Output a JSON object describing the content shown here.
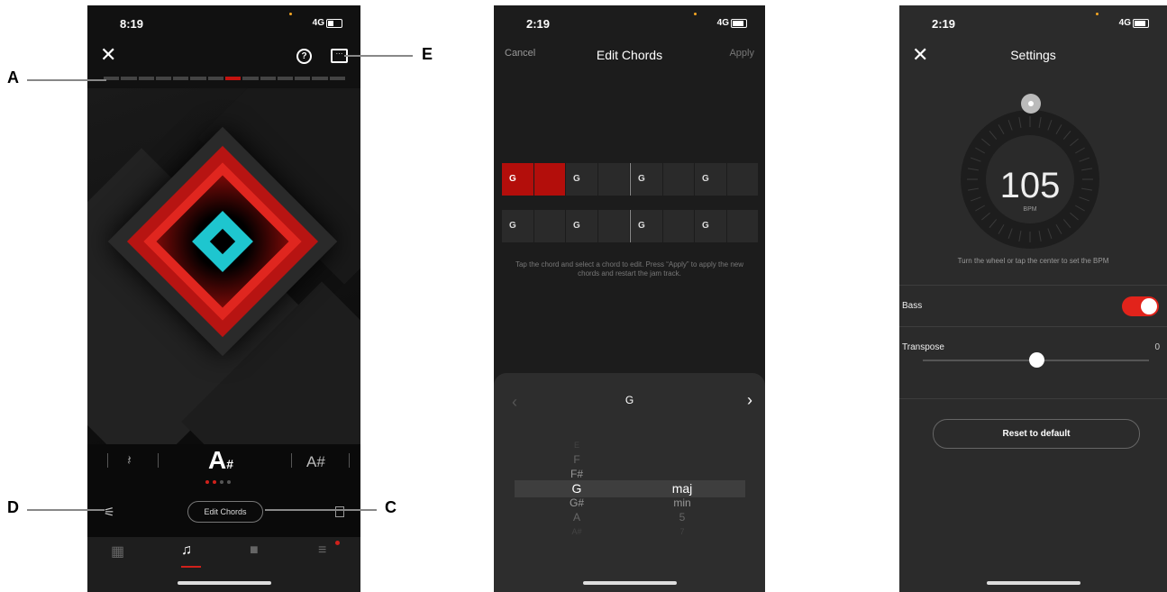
{
  "screen1": {
    "time": "8:19",
    "network": "4G",
    "battery_level": 0.4,
    "progress_segments": 14,
    "active_segment": 7,
    "rest_symbol": "𝄽",
    "current_chord": "A",
    "current_chord_accidental": "#",
    "next_chord": "A#",
    "page_dots": 4,
    "active_dot": 1,
    "edit_chords": "Edit Chords",
    "tabs": [
      "gig-icon",
      "music-icon",
      "video-icon",
      "menu-icon"
    ],
    "active_tab": 1
  },
  "screen2": {
    "time": "2:19",
    "network": "4G",
    "cancel": "Cancel",
    "title": "Edit Chords",
    "apply": "Apply",
    "row1": [
      "G",
      "",
      "G",
      "",
      "G",
      "",
      "G",
      ""
    ],
    "row2": [
      "G",
      "",
      "G",
      "",
      "G",
      "",
      "G",
      ""
    ],
    "hint": "Tap the chord and select a chord to edit. Press “Apply” to apply the new chords and restart the jam track.",
    "selected_root": "G",
    "roots": [
      "E",
      "F",
      "F#",
      "G",
      "G#",
      "A",
      "A#"
    ],
    "qualities": [
      "",
      "",
      "",
      "maj",
      "min",
      "5",
      "7"
    ]
  },
  "screen3": {
    "time": "2:19",
    "network": "4G",
    "title": "Settings",
    "bpm": "105",
    "bpm_unit": "BPM",
    "hint": "Turn the wheel or tap the center to set the BPM",
    "bass_label": "Bass",
    "bass_on": true,
    "transpose_label": "Transpose",
    "transpose_value": "0",
    "reset": "Reset to default"
  },
  "callouts": {
    "a": "A",
    "b": "E",
    "c": "C",
    "d": "D"
  },
  "colors": {
    "accent": "#d0211b",
    "teal": "#1ec6cf"
  }
}
